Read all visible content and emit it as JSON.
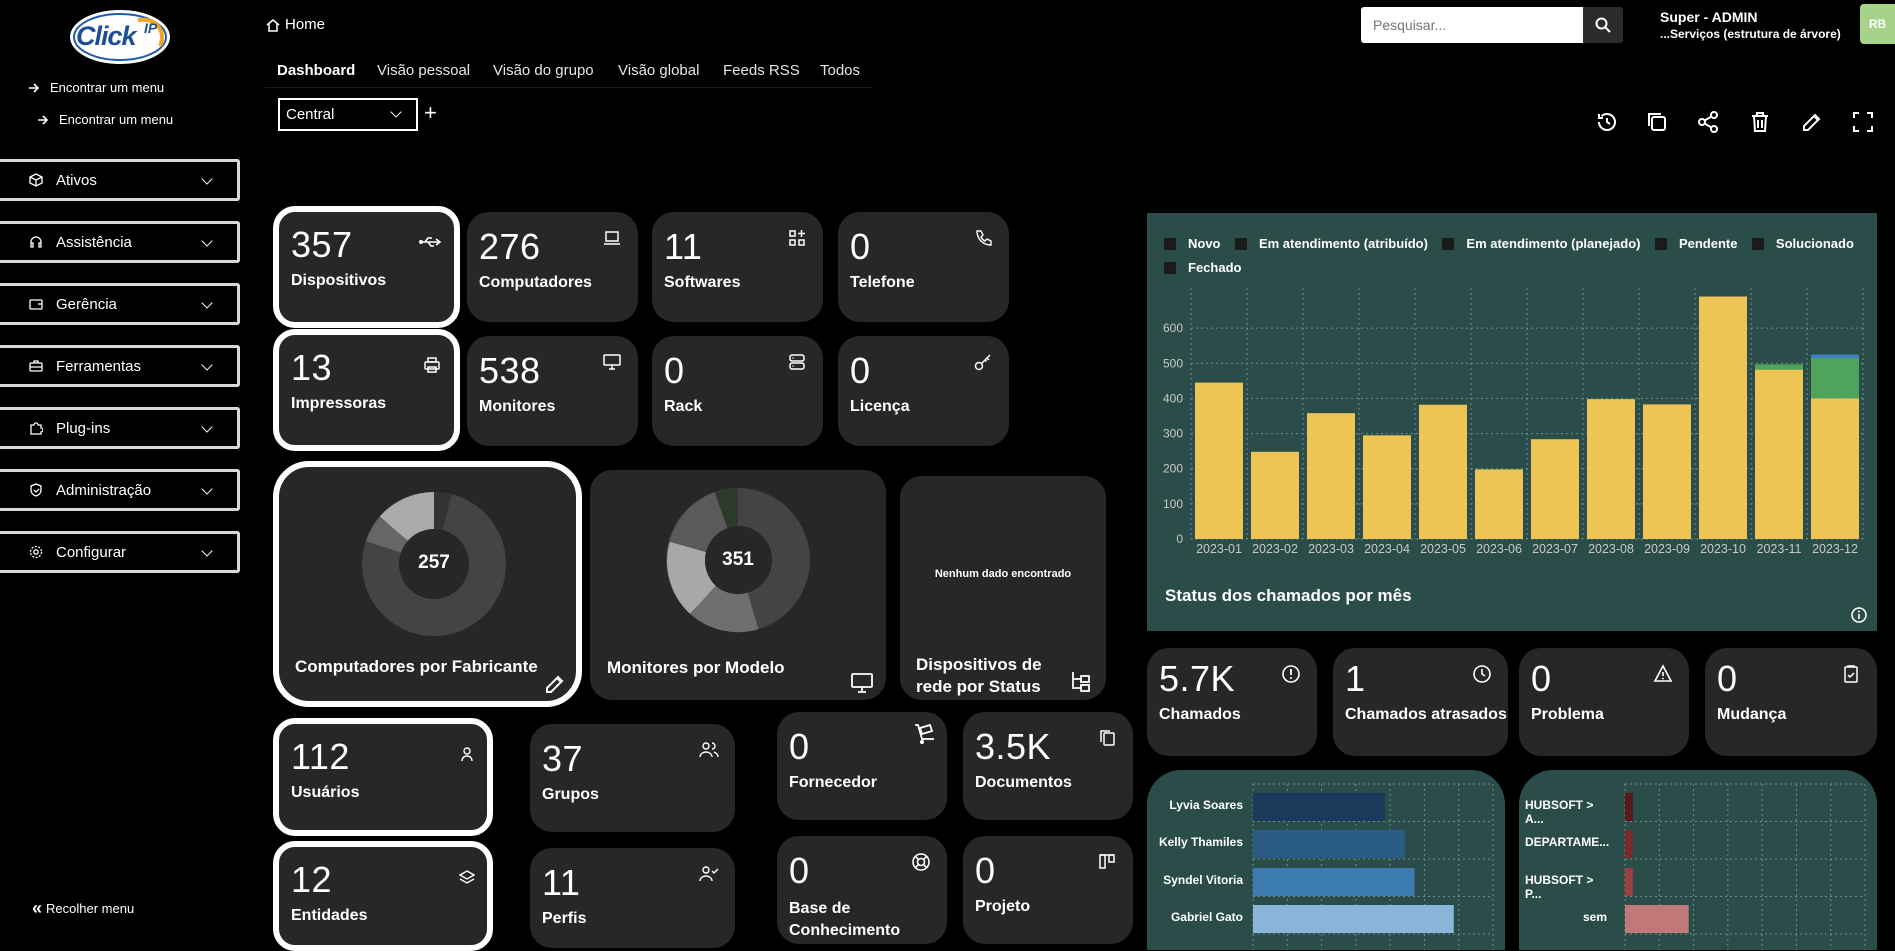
{
  "logo": {
    "text": "Click",
    "sup": "IP"
  },
  "sidebar": {
    "find1": "Encontrar um menu",
    "find2": "Encontrar um menu",
    "items": [
      {
        "label": "Ativos",
        "icon": "box-icon"
      },
      {
        "label": "Assistência",
        "icon": "headset-icon"
      },
      {
        "label": "Gerência",
        "icon": "wallet-icon"
      },
      {
        "label": "Ferramentas",
        "icon": "briefcase-icon"
      },
      {
        "label": "Plug-ins",
        "icon": "puzzle-icon"
      },
      {
        "label": "Administração",
        "icon": "shield-icon"
      },
      {
        "label": "Configurar",
        "icon": "gear-icon"
      }
    ],
    "collapse": "Recolher menu"
  },
  "header": {
    "home": "Home",
    "search_placeholder": "Pesquisar...",
    "user_name": "Super - ADMIN",
    "user_entity": "...Serviços (estrutura de árvore)",
    "avatar": "RB"
  },
  "tabs": [
    "Dashboard",
    "Visão pessoal",
    "Visão do grupo",
    "Visão global",
    "Feeds RSS",
    "Todos"
  ],
  "dashboard_select": "Central",
  "cards": {
    "dispositivos": {
      "value": "357",
      "label": "Dispositivos"
    },
    "computadores": {
      "value": "276",
      "label": "Computadores"
    },
    "softwares": {
      "value": "11",
      "label": "Softwares"
    },
    "telefone": {
      "value": "0",
      "label": "Telefone"
    },
    "impressoras": {
      "value": "13",
      "label": "Impressoras"
    },
    "monitores": {
      "value": "538",
      "label": "Monitores"
    },
    "rack": {
      "value": "0",
      "label": "Rack"
    },
    "licenca": {
      "value": "0",
      "label": "Licença"
    },
    "usuarios": {
      "value": "112",
      "label": "Usuários"
    },
    "grupos": {
      "value": "37",
      "label": "Grupos"
    },
    "fornecedor": {
      "value": "0",
      "label": "Fornecedor"
    },
    "documentos": {
      "value": "3.5K",
      "label": "Documentos"
    },
    "entidades": {
      "value": "12",
      "label": "Entidades"
    },
    "perfis": {
      "value": "11",
      "label": "Perfis"
    },
    "base": {
      "value": "0",
      "label": "Base de Conhecimento"
    },
    "projeto": {
      "value": "0",
      "label": "Projeto"
    },
    "chamados": {
      "value": "5.7K",
      "label": "Chamados"
    },
    "atrasados": {
      "value": "1",
      "label": "Chamados atrasados"
    },
    "problema": {
      "value": "0",
      "label": "Problema"
    },
    "mudanca": {
      "value": "0",
      "label": "Mudança"
    }
  },
  "donuts": {
    "fabricante": {
      "total": "257",
      "title": "Computadores por Fabricante"
    },
    "modelo": {
      "total": "351",
      "title": "Monitores por Modelo"
    },
    "rede": {
      "empty": "Nenhum dado encontrado",
      "title": "Dispositivos de rede por Status"
    }
  },
  "chart_data": [
    {
      "type": "bar",
      "title": "Status dos chamados por mês",
      "categories": [
        "2023-01",
        "2023-02",
        "2023-03",
        "2023-04",
        "2023-05",
        "2023-06",
        "2023-07",
        "2023-08",
        "2023-09",
        "2023-10",
        "2023-11",
        "2023-12"
      ],
      "series": [
        {
          "name": "Novo",
          "color": "#eec555",
          "values": [
            445,
            248,
            358,
            295,
            382,
            198,
            284,
            398,
            383,
            690,
            482,
            400
          ]
        },
        {
          "name": "Em atendimento (atribuído)",
          "color": "#4fa35a",
          "values": [
            0,
            0,
            0,
            0,
            0,
            0,
            0,
            0,
            0,
            0,
            15,
            115
          ]
        },
        {
          "name": "Em atendimento (planejado)",
          "color": "#3f7fbf",
          "values": [
            0,
            0,
            0,
            0,
            0,
            0,
            0,
            0,
            0,
            0,
            0,
            10
          ]
        },
        {
          "name": "Pendente",
          "color": "#e07a3f",
          "values": [
            0,
            0,
            0,
            0,
            0,
            0,
            0,
            0,
            0,
            0,
            0,
            0
          ]
        },
        {
          "name": "Solucionado",
          "color": "#8fb8de",
          "values": [
            0,
            0,
            0,
            0,
            0,
            0,
            0,
            0,
            0,
            0,
            0,
            0
          ]
        },
        {
          "name": "Fechado",
          "color": "#c94d4d",
          "values": [
            0,
            0,
            0,
            0,
            0,
            0,
            0,
            0,
            0,
            0,
            0,
            0
          ]
        }
      ],
      "yticks": [
        0,
        100,
        200,
        300,
        400,
        500,
        600
      ],
      "ylim": [
        0,
        700
      ],
      "legend": "top-left",
      "stacked": true
    },
    {
      "type": "bar",
      "orientation": "horizontal",
      "categories": [
        "Lyvia Soares",
        "Kelly Thamiles",
        "Syndel Vitoria",
        "Gabriel Gato"
      ],
      "values": [
        135,
        155,
        165,
        205
      ],
      "colors": [
        "#1a3a5c",
        "#2a5a86",
        "#3b7bb0",
        "#8ab4d8"
      ]
    },
    {
      "type": "bar",
      "orientation": "horizontal",
      "categories": [
        "HUBSOFT > A...",
        "DEPARTAME...",
        "HUBSOFT > P...",
        "sem"
      ],
      "values": [
        8,
        8,
        8,
        65
      ],
      "colors": [
        "#5a1a1a",
        "#7a2a2a",
        "#9a4040",
        "#c07878"
      ]
    }
  ]
}
